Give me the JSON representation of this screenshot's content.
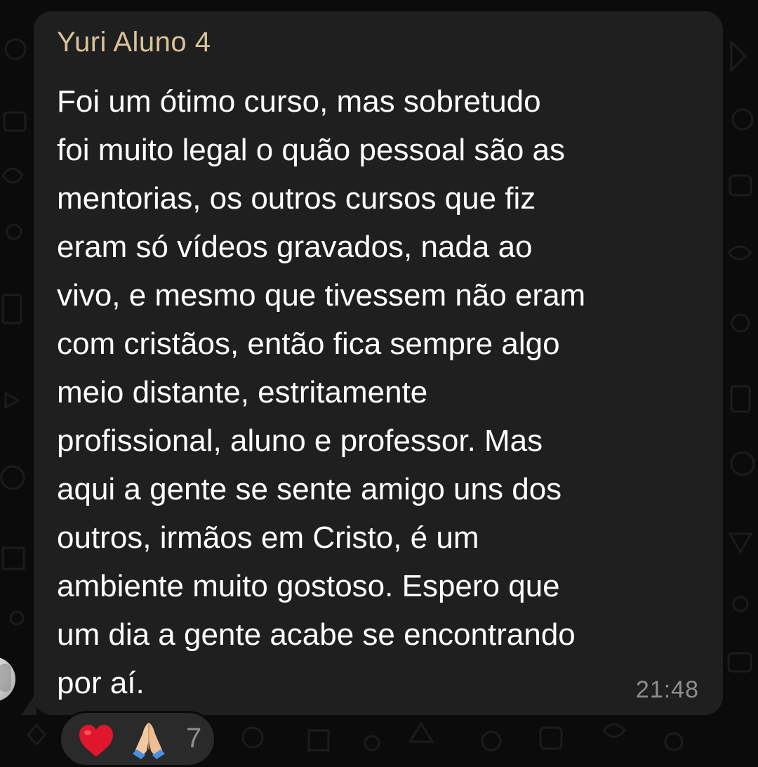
{
  "message": {
    "sender": "Yuri Aluno 4",
    "lines": [
      "Foi um ótimo curso, mas sobretudo",
      "foi muito legal o quão pessoal são as",
      "mentorias, os outros cursos que fiz",
      "eram só vídeos gravados, nada ao",
      "vivo, e mesmo que tivessem não eram",
      "com cristãos, então fica sempre algo",
      "meio distante, estritamente",
      "profissional, aluno e professor. Mas",
      "aqui a gente se sente amigo uns dos",
      "outros, irmãos em Cristo, é um",
      "ambiente muito gostoso. Espero que",
      "um dia a gente acabe se encontrando",
      "por aí."
    ],
    "time": "21:48"
  },
  "reactions": {
    "items": [
      "heart-emoji",
      "praying-hands-emoji"
    ],
    "count": "7"
  },
  "colors": {
    "background": "#0b0b0b",
    "bubble": "#1f1f20",
    "sender_name": "#d9c29a",
    "message_text": "#ffffff",
    "timestamp": "#8e8e90",
    "heart": "#e0172c"
  }
}
